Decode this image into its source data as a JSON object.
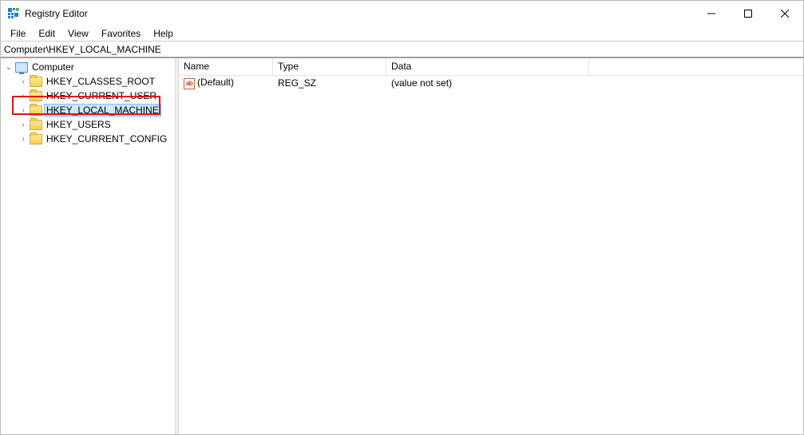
{
  "window": {
    "title": "Registry Editor"
  },
  "menu": {
    "file": "File",
    "edit": "Edit",
    "view": "View",
    "favorites": "Favorites",
    "help": "Help"
  },
  "address": {
    "path": "Computer\\HKEY_LOCAL_MACHINE"
  },
  "tree": {
    "root": "Computer",
    "items": [
      {
        "label": "HKEY_CLASSES_ROOT"
      },
      {
        "label": "HKEY_CURRENT_USER"
      },
      {
        "label": "HKEY_LOCAL_MACHINE"
      },
      {
        "label": "HKEY_USERS"
      },
      {
        "label": "HKEY_CURRENT_CONFIG"
      }
    ],
    "selected_index": 2,
    "highlighted_index": 2
  },
  "list": {
    "columns": {
      "name": "Name",
      "type": "Type",
      "data": "Data"
    },
    "rows": [
      {
        "name": "(Default)",
        "type": "REG_SZ",
        "data": "(value not set)",
        "value_kind": "string"
      }
    ]
  },
  "icons": {
    "string_glyph": "ab"
  }
}
